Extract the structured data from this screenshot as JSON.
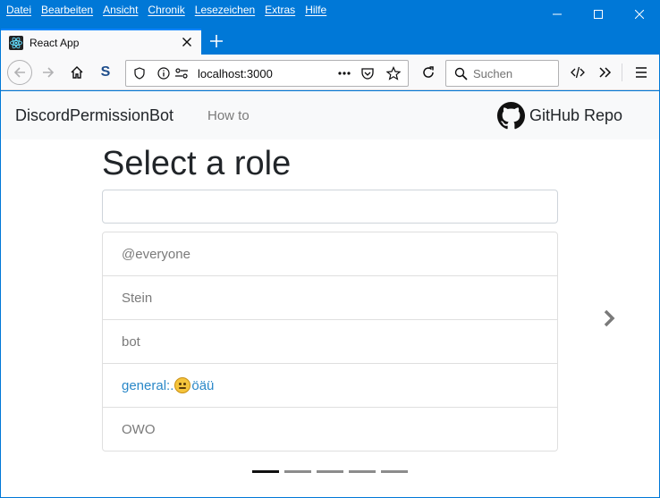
{
  "menu": [
    "Datei",
    "Bearbeiten",
    "Ansicht",
    "Chronik",
    "Lesezeichen",
    "Extras",
    "Hilfe"
  ],
  "tab": {
    "title": "React App"
  },
  "urlbar": {
    "url": "localhost:3000"
  },
  "searchbar": {
    "placeholder": "Suchen"
  },
  "toolbar": {
    "extension_letter": "S"
  },
  "app": {
    "brand": "DiscordPermissionBot",
    "nav_howto": "How to",
    "github_label": "GitHub Repo",
    "heading": "Select a role",
    "input_value": "",
    "roles": [
      {
        "prefix": "@everyone",
        "suffix": ""
      },
      {
        "prefix": "Stein",
        "suffix": ""
      },
      {
        "prefix": "bot",
        "suffix": ""
      },
      {
        "prefix": "general:.",
        "suffix": "öäü"
      },
      {
        "prefix": "OWO",
        "suffix": ""
      }
    ],
    "carousel": {
      "slides": 5,
      "active": 1
    }
  },
  "colors": {
    "accent": "#0078d7",
    "link_active": "#2a88c8"
  },
  "icons": [
    "back-icon",
    "forward-icon",
    "home-icon",
    "shield-icon",
    "info-icon",
    "permissions-icon",
    "more-icon",
    "pocket-icon",
    "star-icon",
    "reload-icon",
    "search-icon",
    "devtools-icon",
    "overflow-icon",
    "hamburger-menu-icon",
    "github-icon",
    "chevron-right-icon",
    "react-icon"
  ]
}
